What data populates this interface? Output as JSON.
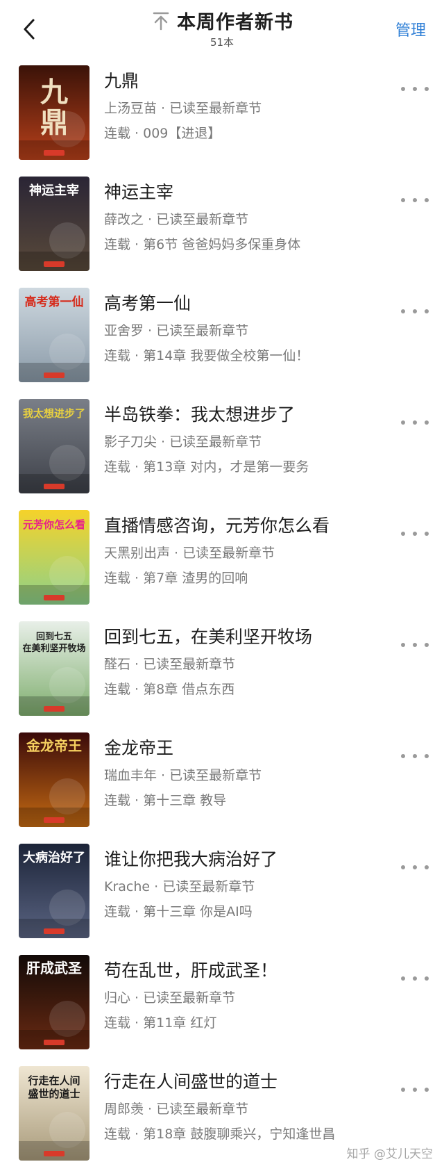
{
  "header": {
    "title": "本周作者新书",
    "count": "51本",
    "manage_label": "管理"
  },
  "icons": {
    "back": "chevron-left-icon",
    "pin": "pin-to-top-icon",
    "more": "more-dots-icon"
  },
  "colors": {
    "accent": "#2f7fd6",
    "meta_text": "#7a7a7a"
  },
  "books": [
    {
      "title": "九鼎",
      "author_status": "上汤豆苗 · 已读至最新章节",
      "chapter": "连载 · 009【进退】",
      "cover_text": "九鼎"
    },
    {
      "title": "神运主宰",
      "author_status": "薛改之 · 已读至最新章节",
      "chapter": "连载 · 第6节 爸爸妈妈多保重身体",
      "cover_text": "神运主宰"
    },
    {
      "title": "高考第一仙",
      "author_status": "亚舍罗 · 已读至最新章节",
      "chapter": "连载 · 第14章 我要做全校第一仙！",
      "cover_text": "高考第一仙"
    },
    {
      "title": "半岛铁拳：我太想进步了",
      "author_status": "影子刀尖 · 已读至最新章节",
      "chapter": "连载 · 第13章 对内，才是第一要务",
      "cover_text": "我太想进步了"
    },
    {
      "title": "直播情感咨询，元芳你怎么看",
      "author_status": "天黑别出声 · 已读至最新章节",
      "chapter": "连载 · 第7章 渣男的回响",
      "cover_text": "元芳你怎么看"
    },
    {
      "title": "回到七五，在美利坚开牧场",
      "author_status": "醛石 · 已读至最新章节",
      "chapter": "连载 · 第8章 借点东西",
      "cover_text": "回到七五 在美利坚开牧场"
    },
    {
      "title": "金龙帝王",
      "author_status": "瑞血丰年 · 已读至最新章节",
      "chapter": "连载 · 第十三章 教导",
      "cover_text": "金龙帝王"
    },
    {
      "title": "谁让你把我大病治好了",
      "author_status": "Krache · 已读至最新章节",
      "chapter": "连载 · 第十三章 你是AI吗",
      "cover_text": "大病治好了"
    },
    {
      "title": "苟在乱世，肝成武圣！",
      "author_status": "归心 · 已读至最新章节",
      "chapter": "连载 · 第11章 红灯",
      "cover_text": "肝成武圣"
    },
    {
      "title": "行走在人间盛世的道士",
      "author_status": "周郎羡 · 已读至最新章节",
      "chapter": "连载 · 第18章 鼓腹聊乘兴，宁知逢世昌",
      "cover_text": "行走在人间 盛世的道士"
    }
  ],
  "watermark": "知乎 @艾儿天空"
}
